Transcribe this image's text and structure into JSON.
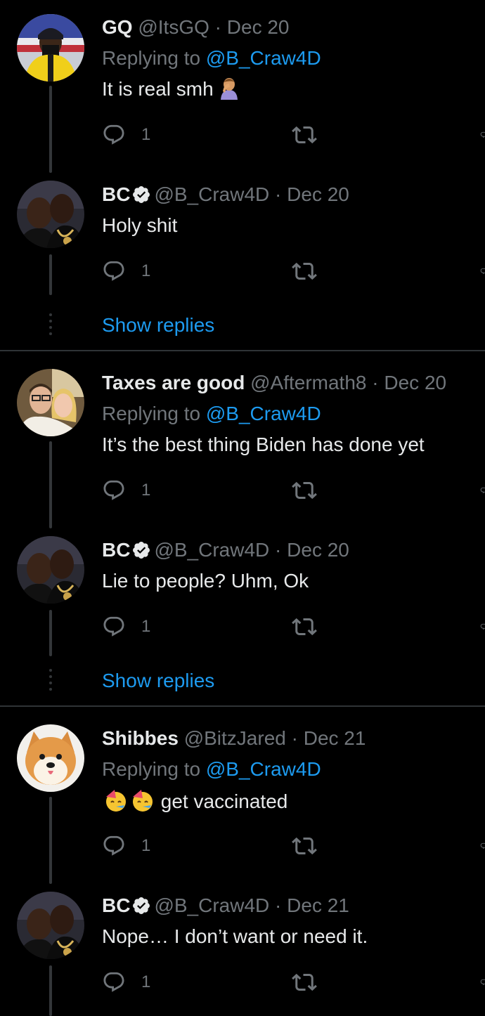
{
  "tweets": [
    {
      "name": "GQ",
      "handle": "@ItsGQ",
      "date": "Dec 20",
      "replying_label": "Replying to",
      "replying_to": "@B_Craw4D",
      "text": "It is real smh",
      "emoji": "person-facepalming",
      "reply_count": "1",
      "verified": false,
      "avatar": "gq-avatar"
    },
    {
      "name": "BC",
      "handle": "@B_Craw4D",
      "date": "Dec 20",
      "replying_label": "",
      "replying_to": "",
      "text": "Holy shit",
      "reply_count": "1",
      "verified": true,
      "avatar": "bc-avatar"
    },
    {
      "name": "Taxes are good",
      "handle": "@Aftermath8",
      "date": "Dec 20",
      "replying_label": "Replying to",
      "replying_to": "@B_Craw4D",
      "text": "It’s the best thing Biden has done yet",
      "reply_count": "1",
      "verified": false,
      "avatar": "taxes-avatar"
    },
    {
      "name": "BC",
      "handle": "@B_Craw4D",
      "date": "Dec 20",
      "replying_label": "",
      "replying_to": "",
      "text": "Lie to people? Uhm, Ok",
      "reply_count": "1",
      "verified": true,
      "avatar": "bc-avatar"
    },
    {
      "name": "Shibbes",
      "handle": "@BitzJared",
      "date": "Dec 21",
      "replying_label": "Replying to",
      "replying_to": "@B_Craw4D",
      "text": "get vaccinated",
      "emoji": "partying-face x2",
      "reply_count": "1",
      "verified": false,
      "avatar": "shiba-avatar"
    },
    {
      "name": "BC",
      "handle": "@B_Craw4D",
      "date": "Dec 21",
      "replying_label": "",
      "replying_to": "",
      "text": "Nope… I don’t want or need it.",
      "reply_count": "1",
      "verified": true,
      "avatar": "bc-avatar"
    }
  ],
  "show_replies_label": "Show replies",
  "separator_dot": "·",
  "icons": {
    "reply": "reply-icon",
    "retweet": "retweet-icon",
    "verified": "verified-badge-icon"
  },
  "colors": {
    "background": "#000000",
    "text": "#e7e9ea",
    "muted": "#71767b",
    "link": "#1d9bf0"
  }
}
